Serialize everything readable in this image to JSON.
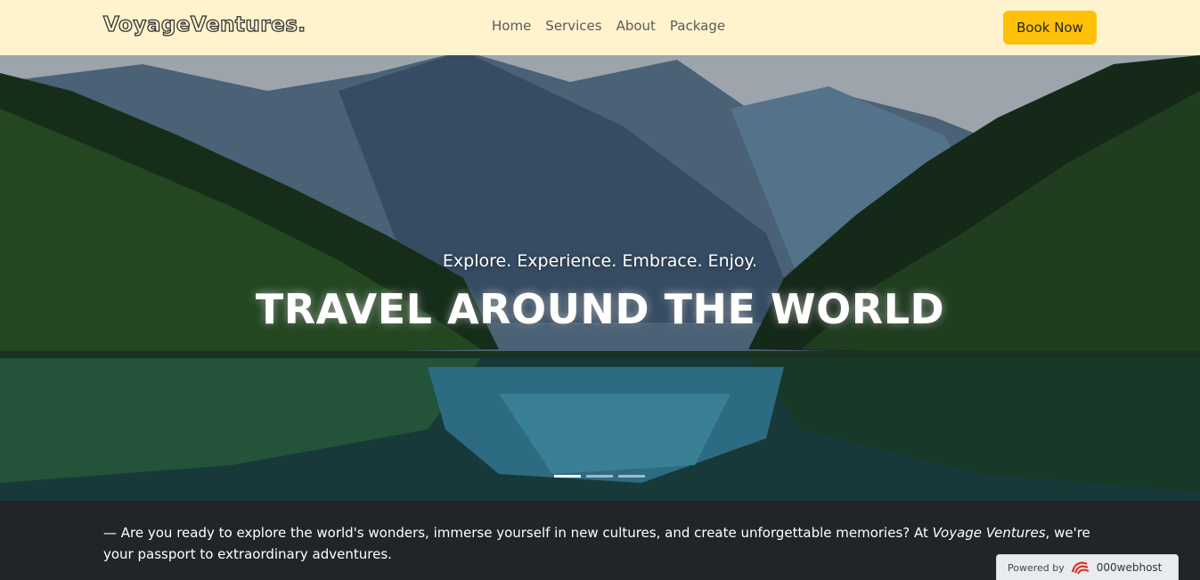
{
  "navbar": {
    "brand": "VoyageVentures.",
    "links": [
      "Home",
      "Services",
      "About",
      "Package"
    ],
    "cta_label": "Book Now"
  },
  "hero": {
    "subtitle": "Explore. Experience. Embrace. Enjoy.",
    "title": "TRAVEL AROUND THE WORLD",
    "slide_count": 3,
    "active_slide": 1
  },
  "intro": {
    "prefix": "— Are you ready to explore the world's wonders, immerse yourself in new cultures, and create unforgettable memories? At ",
    "brand_italic": "Voyage Ventures",
    "suffix": ", we're your passport to extraordinary adventures."
  },
  "badge": {
    "powered_by": "Powered by",
    "name": "000webhost",
    "icon": "000webhost-logo-icon"
  },
  "colors": {
    "navbar_bg": "#fff3cd",
    "cta_bg": "#ffc107",
    "section_bg": "#212529"
  }
}
